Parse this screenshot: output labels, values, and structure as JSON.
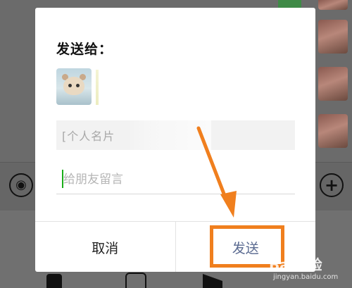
{
  "dialog": {
    "title": "发送给：",
    "recipient": {
      "avatar": "hamster-avatar"
    },
    "message_preview": "[个人名片",
    "message_input": {
      "value": "",
      "placeholder": "给朋友留言"
    },
    "buttons": {
      "cancel_label": "取消",
      "send_label": "发送"
    }
  },
  "background": {
    "left_icon": "voice-icon",
    "right_icon": "plus-icon",
    "left_symbol": "◉",
    "right_symbol": "+"
  },
  "watermark": {
    "logo": "Bai经验",
    "url": "jingyan.baidu.com"
  },
  "colors": {
    "accent_orange": "#f07f1e",
    "send_blue": "#5b6b91",
    "caret_green": "#1aad19"
  }
}
